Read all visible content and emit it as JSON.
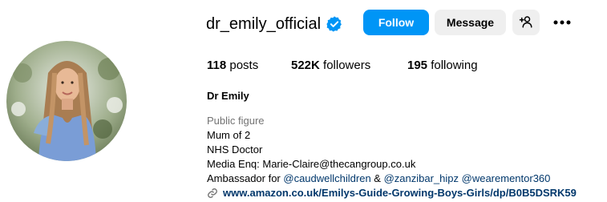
{
  "profile": {
    "username": "dr_emily_official",
    "verified": true,
    "full_name": "Dr Emily",
    "category": "Public figure"
  },
  "actions": {
    "follow_label": "Follow",
    "message_label": "Message",
    "add_user_icon": "person-plus-icon",
    "more_icon": "more-horizontal-icon"
  },
  "stats": {
    "posts_count": "118",
    "posts_label": "posts",
    "followers_count": "522K",
    "followers_label": "followers",
    "following_count": "195",
    "following_label": "following"
  },
  "bio": {
    "line1": "Mum of 2",
    "line2": "NHS Doctor",
    "line3": "Media Enq: Marie-Claire@thecangroup.co.uk",
    "line4_prefix": "Ambassador for ",
    "mention1": "@caudwellchildren",
    "line4_amp": " & ",
    "mention2": "@zanzibar_hipz",
    "mention3": "@wearementor360"
  },
  "link": {
    "text": "www.amazon.co.uk/Emilys-Guide-Growing-Boys-Girls/dp/B0B5DSRK59",
    "icon": "link-icon"
  },
  "colors": {
    "primary": "#0095f6",
    "secondary_button": "#efefef",
    "link": "#00376b",
    "muted": "#737373",
    "verified_badge": "#0095f6"
  }
}
